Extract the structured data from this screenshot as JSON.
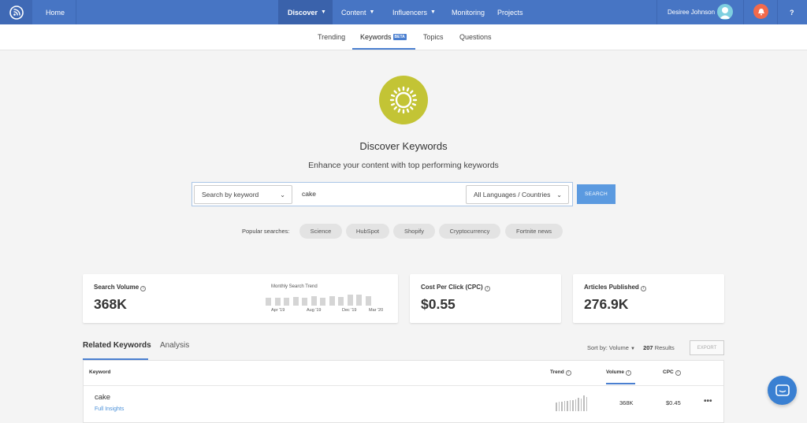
{
  "topbar": {
    "home": "Home",
    "discover": "Discover",
    "content": "Content",
    "influencers": "Influencers",
    "monitoring": "Monitoring",
    "projects": "Projects",
    "user_name": "Desiree Johnson",
    "help": "?"
  },
  "subnav": {
    "trending": "Trending",
    "keywords": "Keywords",
    "beta": "BETA",
    "topics": "Topics",
    "questions": "Questions"
  },
  "hero": {
    "title": "Discover Keywords",
    "subtitle": "Enhance your content with top performing keywords"
  },
  "search": {
    "mode": "Search by keyword",
    "query": "cake",
    "locale": "All Languages / Countries",
    "button": "SEARCH"
  },
  "popular": {
    "label": "Popular searches:",
    "items": [
      "Science",
      "HubSpot",
      "Shopify",
      "Cryptocurrency",
      "Fortnite news"
    ]
  },
  "stats": {
    "volume_title": "Search Volume",
    "volume_value": "368K",
    "trend_title": "Monthly Search Trend",
    "trend_values": [
      0.62,
      0.62,
      0.62,
      0.7,
      0.62,
      0.78,
      0.62,
      0.74,
      0.66,
      0.86,
      0.86,
      0.78
    ],
    "trend_labels": [
      "Apr '19",
      "Aug '19",
      "Dec '19",
      "Mar '20"
    ],
    "cpc_title": "Cost Per Click (CPC)",
    "cpc_value": "$0.55",
    "articles_title": "Articles Published",
    "articles_value": "276.9K"
  },
  "results": {
    "tab_related": "Related Keywords",
    "tab_analysis": "Analysis",
    "sort": "Sort by: Volume",
    "count": "207",
    "count_label": "Results",
    "export": "EXPORT",
    "columns": {
      "keyword": "Keyword",
      "trend": "Trend",
      "volume": "Volume",
      "cpc": "CPC"
    },
    "rows": [
      {
        "keyword": "cake",
        "link": "Full Insights",
        "volume": "368K",
        "cpc": "$0.45",
        "trend": [
          0.55,
          0.6,
          0.6,
          0.65,
          0.65,
          0.7,
          0.7,
          0.75,
          0.85,
          0.8,
          1.0,
          0.9
        ]
      }
    ]
  },
  "colors": {
    "brand_blue": "#4775c4",
    "accent_blue": "#4a7fd0",
    "sun": "#c3c435",
    "bell": "#f26a4b"
  }
}
